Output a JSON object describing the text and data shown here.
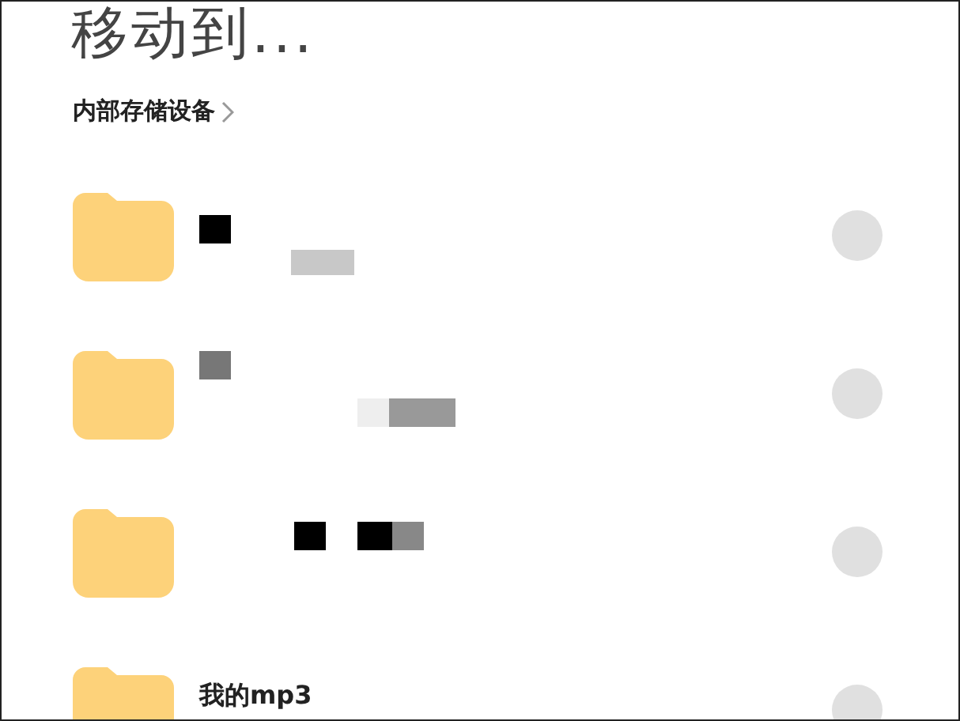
{
  "title": "移动到...",
  "breadcrumb": {
    "label": "内部存储设备"
  },
  "folders": [
    {
      "kind": "redacted",
      "selected": false
    },
    {
      "kind": "redacted",
      "selected": false
    },
    {
      "kind": "redacted",
      "selected": false
    },
    {
      "kind": "named",
      "name": "我的mp3",
      "selected": false
    }
  ]
}
